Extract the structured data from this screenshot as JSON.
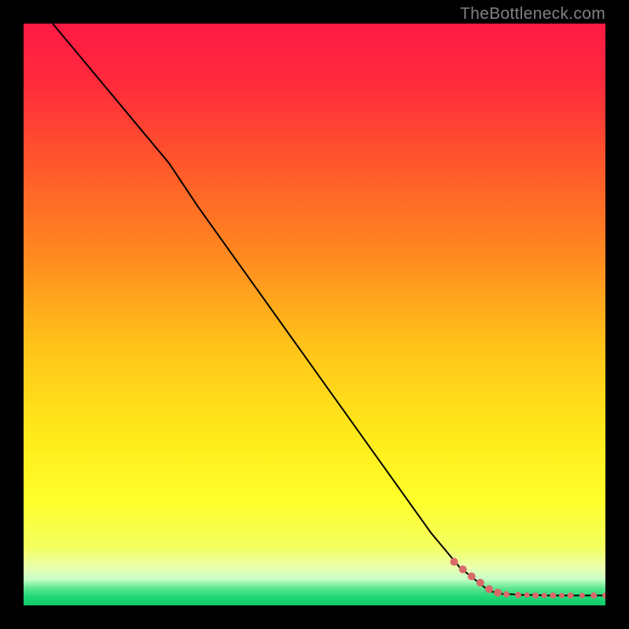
{
  "watermark": "TheBottleneck.com",
  "chart_data": {
    "type": "line",
    "title": "",
    "xlabel": "",
    "ylabel": "",
    "xlim": [
      0,
      100
    ],
    "ylim": [
      0,
      100
    ],
    "gradient": {
      "stops": [
        {
          "offset": 0.0,
          "color": "#ff1a44"
        },
        {
          "offset": 0.1,
          "color": "#ff2a3c"
        },
        {
          "offset": 0.25,
          "color": "#ff5a2a"
        },
        {
          "offset": 0.4,
          "color": "#ff8a20"
        },
        {
          "offset": 0.55,
          "color": "#ffc21a"
        },
        {
          "offset": 0.7,
          "color": "#ffe81a"
        },
        {
          "offset": 0.82,
          "color": "#ffff2a"
        },
        {
          "offset": 0.9,
          "color": "#f4ff60"
        },
        {
          "offset": 0.935,
          "color": "#eaffb0"
        },
        {
          "offset": 0.955,
          "color": "#c8ffc8"
        },
        {
          "offset": 0.97,
          "color": "#60e890"
        },
        {
          "offset": 0.985,
          "color": "#20d878"
        },
        {
          "offset": 1.0,
          "color": "#10c868"
        }
      ]
    },
    "series": [
      {
        "name": "bottleneck-curve",
        "x": [
          5,
          10,
          15,
          20,
          25,
          27,
          30,
          35,
          40,
          45,
          50,
          55,
          60,
          65,
          70,
          75,
          80,
          82,
          84,
          86,
          88,
          90,
          92,
          94,
          96,
          98,
          100
        ],
        "y": [
          100,
          94,
          88,
          82,
          76,
          73,
          68.5,
          61.5,
          54.5,
          47.5,
          40.5,
          33.5,
          26.5,
          19.5,
          12.5,
          6.5,
          2.5,
          2.0,
          1.9,
          1.8,
          1.8,
          1.7,
          1.7,
          1.7,
          1.7,
          1.7,
          1.7
        ]
      }
    ],
    "markers": {
      "name": "highlight-points",
      "color": "#d96a6a",
      "points": [
        {
          "x": 74,
          "y": 7.5,
          "r": 5
        },
        {
          "x": 75.5,
          "y": 6.2,
          "r": 5
        },
        {
          "x": 77,
          "y": 5.0,
          "r": 5
        },
        {
          "x": 78.5,
          "y": 3.9,
          "r": 5
        },
        {
          "x": 80,
          "y": 2.8,
          "r": 5
        },
        {
          "x": 81.5,
          "y": 2.2,
          "r": 5
        },
        {
          "x": 83,
          "y": 1.9,
          "r": 4
        },
        {
          "x": 85,
          "y": 1.8,
          "r": 4
        },
        {
          "x": 86.5,
          "y": 1.8,
          "r": 3.5
        },
        {
          "x": 88,
          "y": 1.7,
          "r": 4
        },
        {
          "x": 89.5,
          "y": 1.7,
          "r": 3.5
        },
        {
          "x": 91,
          "y": 1.7,
          "r": 4
        },
        {
          "x": 92.5,
          "y": 1.7,
          "r": 3.5
        },
        {
          "x": 94,
          "y": 1.7,
          "r": 4
        },
        {
          "x": 96,
          "y": 1.7,
          "r": 3.5
        },
        {
          "x": 98,
          "y": 1.7,
          "r": 4
        },
        {
          "x": 100,
          "y": 1.7,
          "r": 4
        }
      ]
    }
  }
}
